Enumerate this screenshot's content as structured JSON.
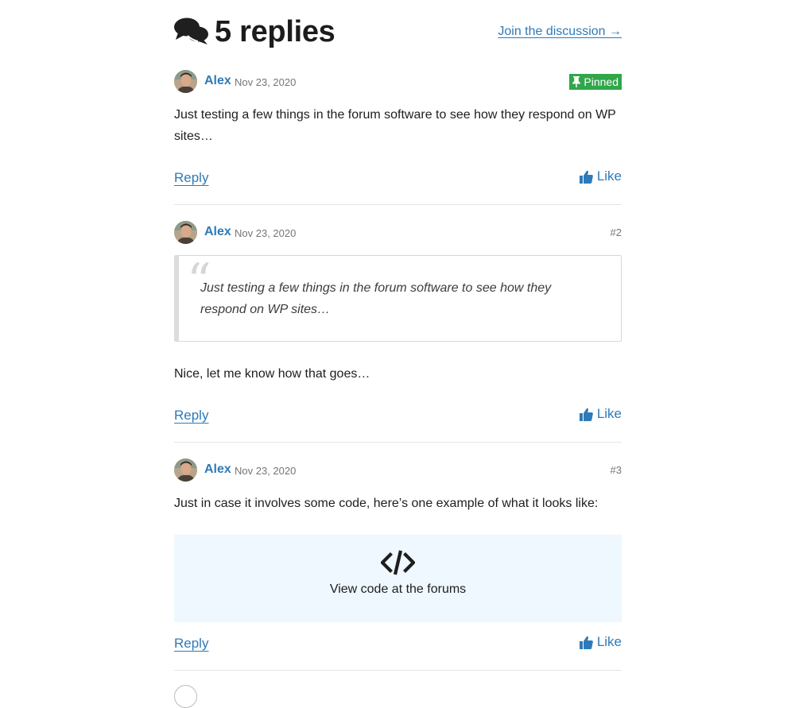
{
  "header": {
    "title": "5 replies",
    "join_link": "Join the discussion →",
    "icon": "comments-icon"
  },
  "posts": [
    {
      "author": "Alex",
      "date": "Nov 23, 2020",
      "badge": "Pinned",
      "body": "Just testing a few things in the forum software to see how they respond on WP sites…",
      "reply_label": "Reply",
      "like_label": "Like"
    },
    {
      "author": "Alex",
      "date": "Nov 23, 2020",
      "number": "#2",
      "quote_mark": "“",
      "quote": "Just testing a few things in the forum software to see how they respond on WP sites…",
      "body": "Nice, let me know how that goes…",
      "reply_label": "Reply",
      "like_label": "Like"
    },
    {
      "author": "Alex",
      "date": "Nov 23, 2020",
      "number": "#3",
      "body": "Just in case it involves some code, here’s one example of what it looks like:",
      "code_label": "View code at the forums",
      "reply_label": "Reply",
      "like_label": "Like"
    }
  ],
  "colors": {
    "link": "#2e7ab8",
    "pinned_badge": "#30a74a",
    "code_box_bg": "#eef8fe"
  }
}
